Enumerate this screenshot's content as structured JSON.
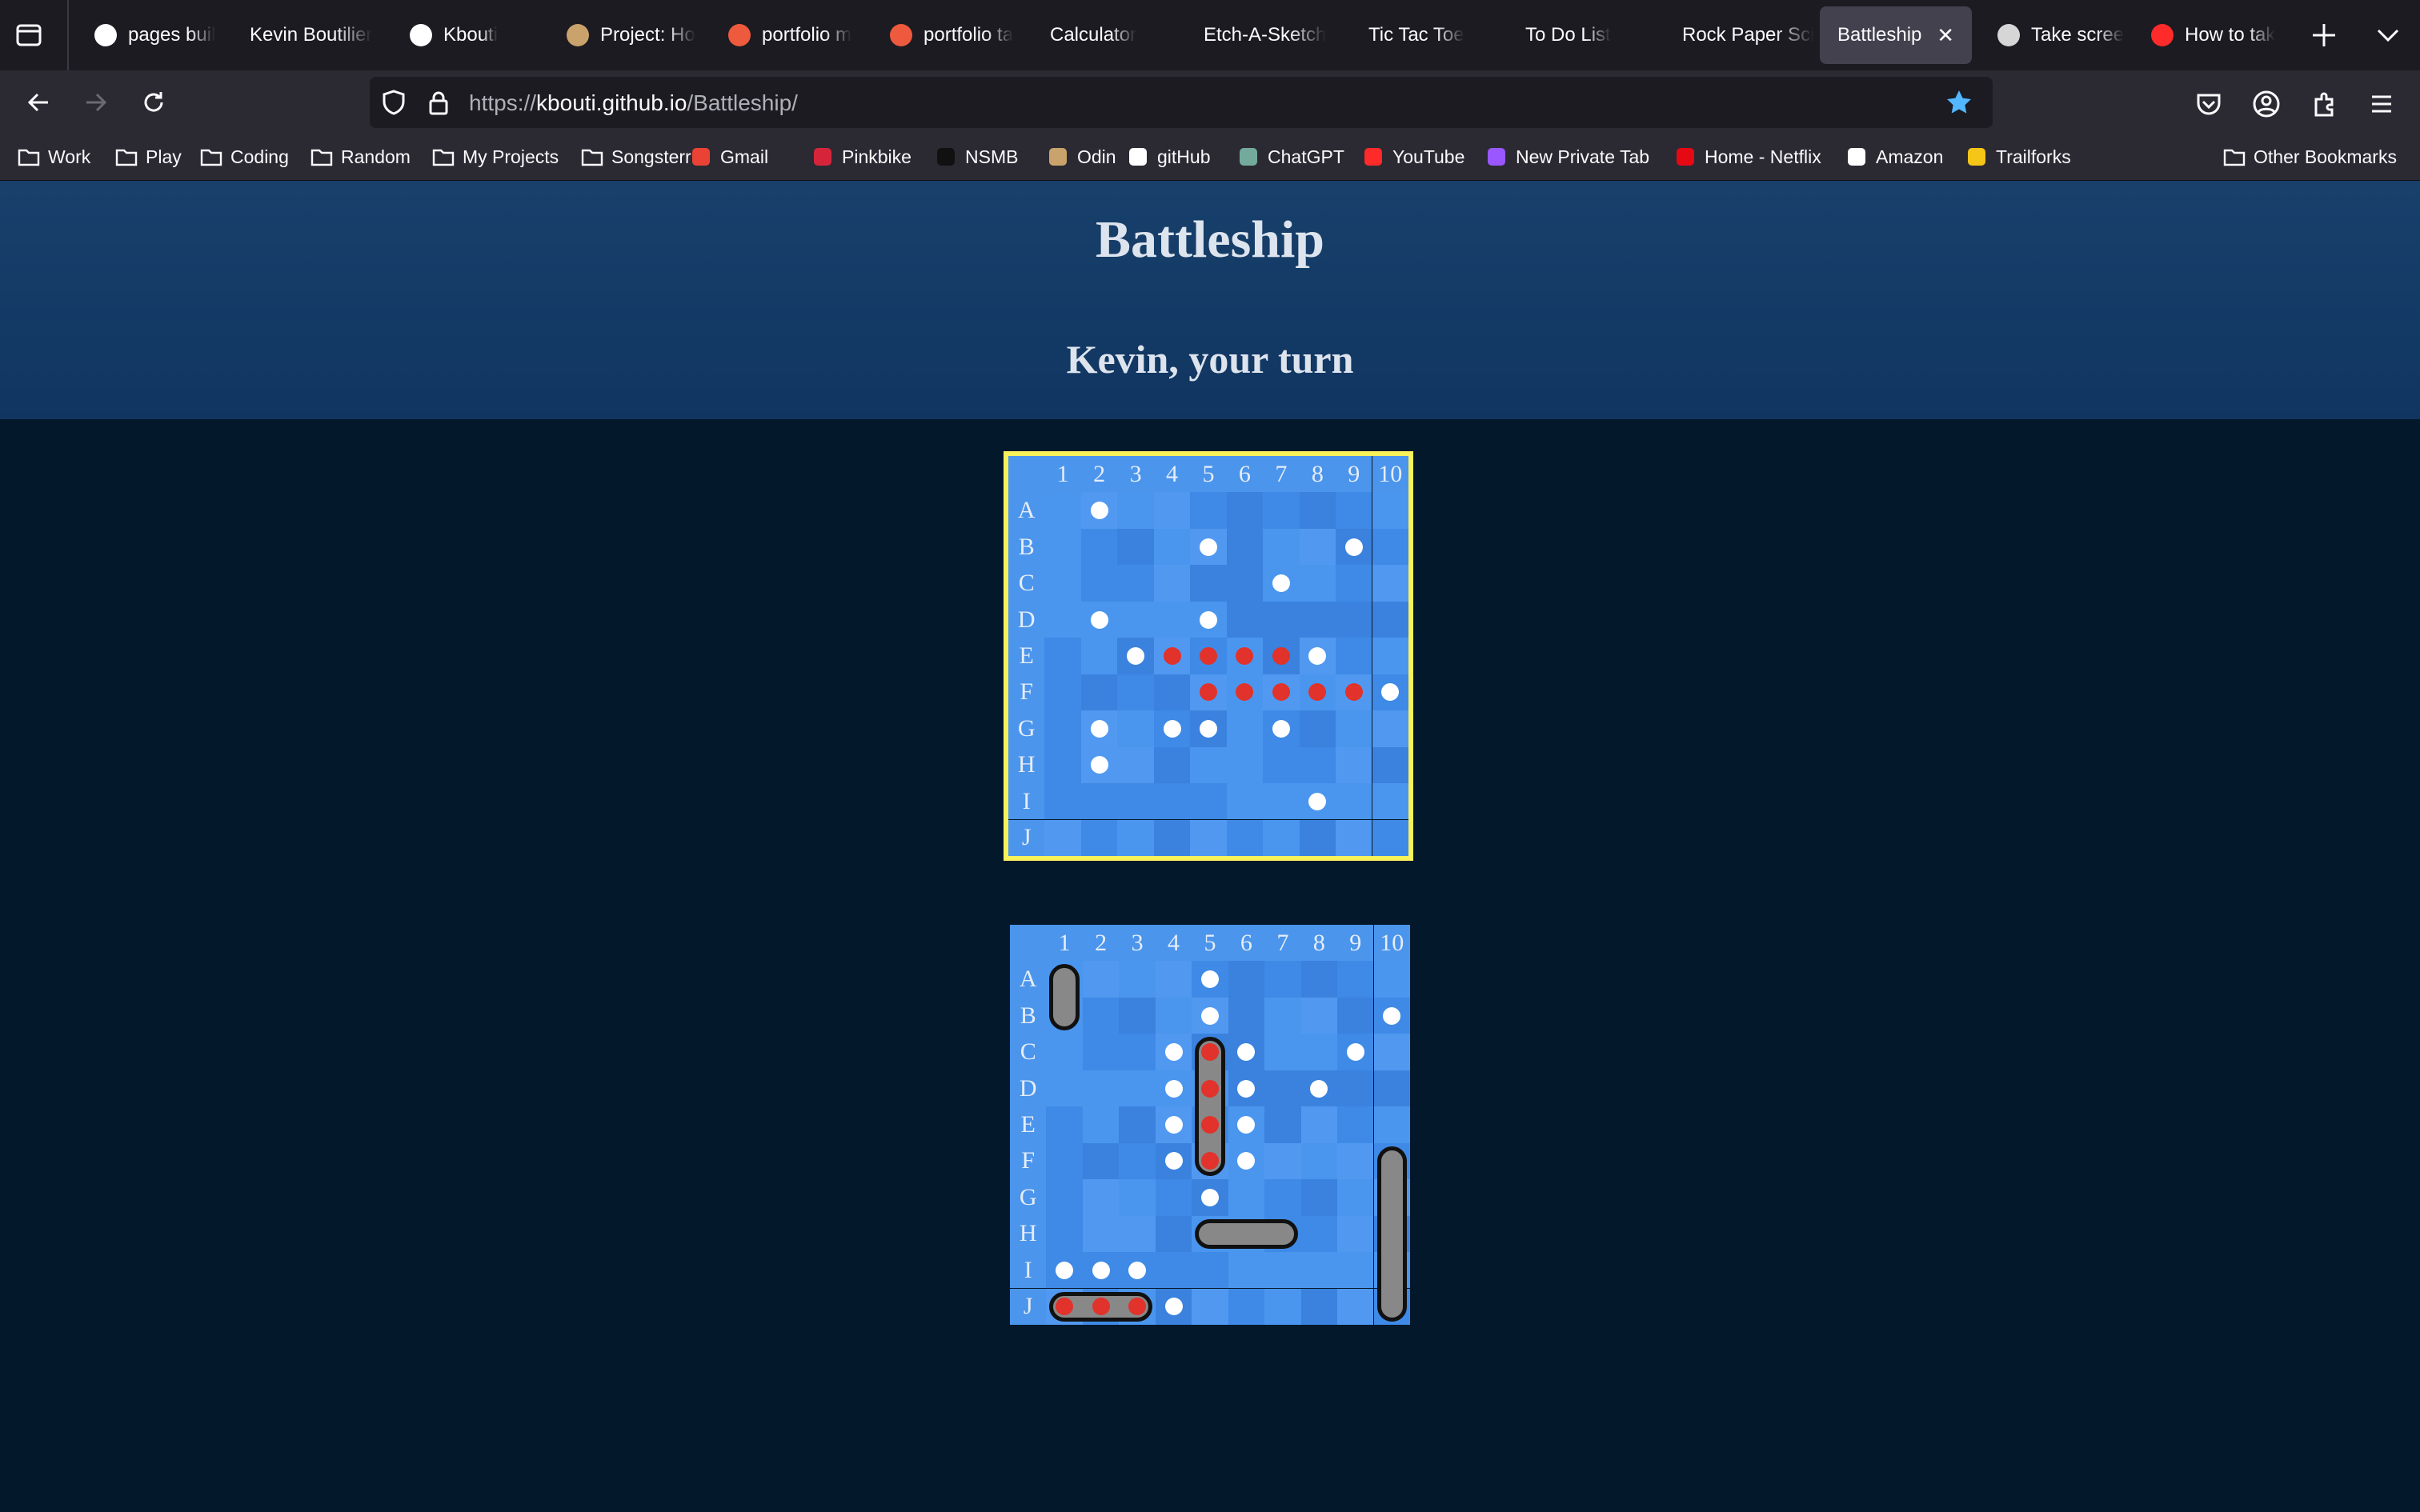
{
  "browser": {
    "tabs": [
      {
        "label": "pages buil",
        "icon": "github-icon",
        "active": false
      },
      {
        "label": "Kevin Boutilier",
        "icon": "",
        "active": false
      },
      {
        "label": "Kbouti",
        "icon": "github-icon",
        "active": false
      },
      {
        "label": "Project: Ho",
        "icon": "odin-icon",
        "active": false
      },
      {
        "label": "portfolio m",
        "icon": "bolt-icon",
        "active": false
      },
      {
        "label": "portfolio ta",
        "icon": "bolt-icon",
        "active": false
      },
      {
        "label": "Calculator",
        "icon": "",
        "active": false
      },
      {
        "label": "Etch-A-Sketch",
        "icon": "",
        "active": false
      },
      {
        "label": "Tic Tac Toe",
        "icon": "",
        "active": false
      },
      {
        "label": "To Do List",
        "icon": "",
        "active": false
      },
      {
        "label": "Rock Paper Sci",
        "icon": "",
        "active": false
      },
      {
        "label": "Battleship",
        "icon": "",
        "active": true
      },
      {
        "label": "Take scree",
        "icon": "apple-icon",
        "active": false
      },
      {
        "label": "How to tak",
        "icon": "youtube-icon",
        "active": false
      }
    ],
    "url": {
      "scheme": "https://",
      "host": "kbouti.github.io",
      "path": "/Battleship/"
    },
    "bookmarks": [
      {
        "label": "Work",
        "icon": "folder-icon"
      },
      {
        "label": "Play",
        "icon": "folder-icon"
      },
      {
        "label": "Coding",
        "icon": "folder-icon"
      },
      {
        "label": "Random",
        "icon": "folder-icon"
      },
      {
        "label": "My Projects",
        "icon": "folder-icon"
      },
      {
        "label": "Songsterr",
        "icon": "folder-icon"
      },
      {
        "label": "Gmail",
        "icon": "gmail-icon"
      },
      {
        "label": "Pinkbike",
        "icon": "pinkbike-icon"
      },
      {
        "label": "NSMB",
        "icon": "nsmb-icon"
      },
      {
        "label": "Odin",
        "icon": "odin-icon"
      },
      {
        "label": "gitHub",
        "icon": "github-icon"
      },
      {
        "label": "ChatGPT",
        "icon": "chatgpt-icon"
      },
      {
        "label": "YouTube",
        "icon": "youtube-icon"
      },
      {
        "label": "New Private Tab",
        "icon": "private-tab-icon"
      },
      {
        "label": "Home - Netflix",
        "icon": "netflix-icon"
      },
      {
        "label": "Amazon",
        "icon": "amazon-icon"
      },
      {
        "label": "Trailforks",
        "icon": "trailforks-icon"
      }
    ],
    "other_bookmarks": "Other Bookmarks"
  },
  "game": {
    "title": "Battleship",
    "status": "Kevin, your turn",
    "columns": [
      "1",
      "2",
      "3",
      "4",
      "5",
      "6",
      "7",
      "8",
      "9",
      "10"
    ],
    "rows": [
      "A",
      "B",
      "C",
      "D",
      "E",
      "F",
      "G",
      "H",
      "I",
      "J"
    ],
    "colors": {
      "hit": "#e1322b",
      "miss": "#ffffff",
      "active_border": "#f8f15a",
      "ship": "#888888"
    },
    "opponent_board": {
      "active": true,
      "hits": [
        "E4",
        "E5",
        "E6",
        "E7",
        "F5",
        "F6",
        "F7",
        "F8",
        "F9"
      ],
      "misses": [
        "A2",
        "B5",
        "B9",
        "C7",
        "D2",
        "D5",
        "E3",
        "E8",
        "F10",
        "G2",
        "G4",
        "G5",
        "G7",
        "H2",
        "I8"
      ]
    },
    "player_board": {
      "active": false,
      "ships": [
        {
          "from": "A1",
          "to": "B1"
        },
        {
          "from": "C5",
          "to": "F5"
        },
        {
          "from": "H5",
          "to": "H7"
        },
        {
          "from": "F10",
          "to": "J10"
        },
        {
          "from": "J1",
          "to": "J3"
        }
      ],
      "hits": [
        "C5",
        "D5",
        "E5",
        "F5",
        "J1",
        "J2",
        "J3"
      ],
      "misses": [
        "A5",
        "B5",
        "B10",
        "C4",
        "C6",
        "C9",
        "D4",
        "D6",
        "D8",
        "E4",
        "E6",
        "F4",
        "F6",
        "G5",
        "I1",
        "I2",
        "I3",
        "J4"
      ]
    }
  }
}
